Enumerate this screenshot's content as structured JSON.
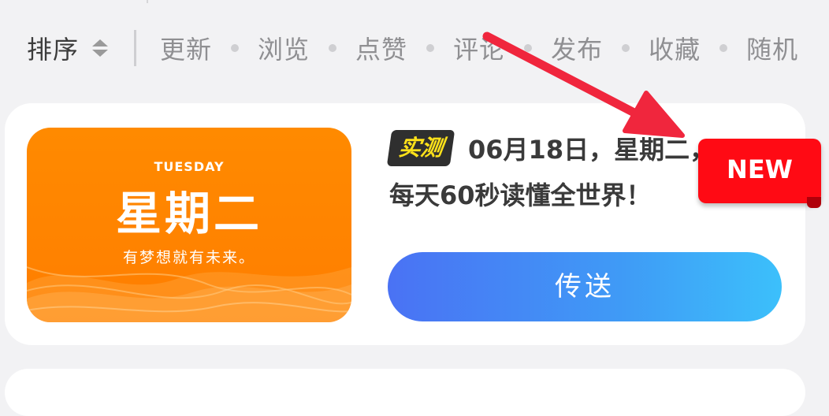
{
  "sort": {
    "label": "排序",
    "options": [
      "更新",
      "浏览",
      "点赞",
      "评论",
      "发布",
      "收藏",
      "随机"
    ]
  },
  "card": {
    "thumbnail": {
      "day": "TUESDAY",
      "title": "星期二",
      "motto": "有梦想就有未来。"
    },
    "tag": "实测",
    "title": "06月18日，星期二，每天60秒读懂全世界！",
    "button_label": "传送",
    "badge": "NEW"
  },
  "colors": {
    "thumbnail_orange": "#ff8300",
    "button_gradient_start": "#4a72f4",
    "button_gradient_end": "#3cc0fb",
    "badge_red": "#ff0a14",
    "annotation_arrow": "#f0263d",
    "tag_text": "#ffe21a"
  }
}
